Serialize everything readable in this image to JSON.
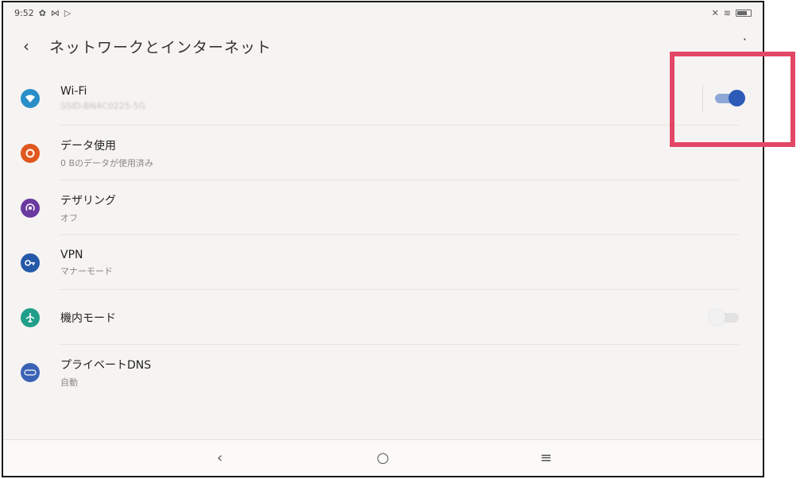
{
  "status_bar": {
    "time": "9:52",
    "left_icons": [
      "gear-icon",
      "mail-icon",
      "play-store-icon"
    ],
    "right_icons": [
      "mute-icon",
      "wifi-icon",
      "battery-icon"
    ]
  },
  "header": {
    "back_label": "‹",
    "title": "ネットワークとインターネット"
  },
  "rows": [
    {
      "title": "Wi-Fi",
      "subtitle": "SSID-BN4C0225-5G",
      "icon": "wifi-icon",
      "color": "#2a8fc8",
      "toggle": "on"
    },
    {
      "title": "データ使用",
      "subtitle": "0 Bのデータが使用済み",
      "icon": "data-usage-icon",
      "color": "#e0571f"
    },
    {
      "title": "テザリング",
      "subtitle": "オフ",
      "icon": "tethering-icon",
      "color": "#6b3aa0"
    },
    {
      "title": "VPN",
      "subtitle": "マナーモード",
      "icon": "vpn-key-icon",
      "color": "#2459a8"
    },
    {
      "title": "機内モード",
      "subtitle": "",
      "icon": "airplane-icon",
      "color": "#1f9e8a",
      "toggle": "off"
    },
    {
      "title": "プライベートDNS",
      "subtitle": "自動",
      "icon": "dns-icon",
      "color": "#3a63b5"
    }
  ],
  "nav": {
    "back": "‹",
    "home": "○",
    "recents": "≡"
  },
  "colors": {
    "highlight": "#e34767",
    "toggle_on": "#2c5cb8"
  }
}
